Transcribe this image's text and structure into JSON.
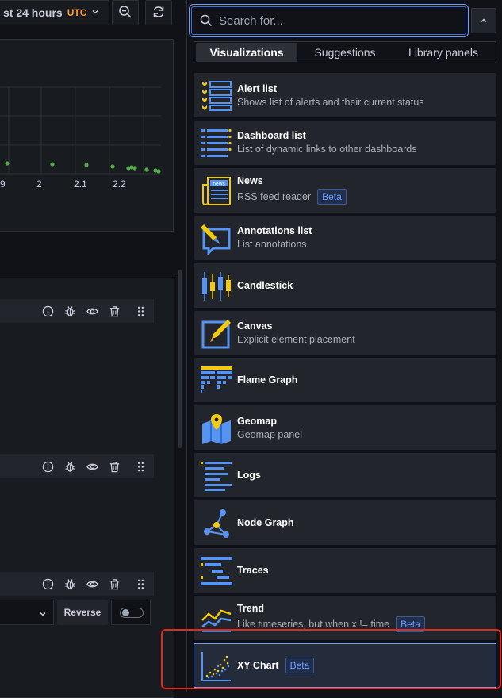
{
  "toolbar": {
    "time_range_label": "st 24 hours",
    "timezone_label": "UTC",
    "icons": [
      "chevron-down-icon",
      "zoom-out-icon",
      "refresh-icon"
    ]
  },
  "graph": {
    "x_ticks": [
      "9",
      "2",
      "2.1",
      "2.2"
    ],
    "point_color": "#56a64b"
  },
  "query_rows": {
    "icons": [
      "info-icon",
      "bug-icon",
      "eye-icon",
      "trash-icon",
      "drag-handle-icon"
    ],
    "reverse_label": "Reverse"
  },
  "search": {
    "placeholder": "Search for..."
  },
  "tabs": [
    {
      "label": "Visualizations",
      "active": true
    },
    {
      "label": "Suggestions",
      "active": false
    },
    {
      "label": "Library panels",
      "active": false
    }
  ],
  "visualizations": [
    {
      "name": "Alert list",
      "description": "Shows list of alerts and their current status",
      "icon": "alert-list-icon"
    },
    {
      "name": "Dashboard list",
      "description": "List of dynamic links to other dashboards",
      "icon": "dashboard-list-icon"
    },
    {
      "name": "News",
      "description": "RSS feed reader",
      "badge": "Beta",
      "icon": "news-icon"
    },
    {
      "name": "Annotations list",
      "description": "List annotations",
      "icon": "annotations-list-icon"
    },
    {
      "name": "Candlestick",
      "description": "",
      "icon": "candlestick-icon"
    },
    {
      "name": "Canvas",
      "description": "Explicit element placement",
      "icon": "canvas-icon"
    },
    {
      "name": "Flame Graph",
      "description": "",
      "icon": "flame-graph-icon"
    },
    {
      "name": "Geomap",
      "description": "Geomap panel",
      "icon": "geomap-icon"
    },
    {
      "name": "Logs",
      "description": "",
      "icon": "logs-icon"
    },
    {
      "name": "Node Graph",
      "description": "",
      "icon": "node-graph-icon"
    },
    {
      "name": "Traces",
      "description": "",
      "icon": "traces-icon"
    },
    {
      "name": "Trend",
      "description": "Like timeseries, but when x != time",
      "badge": "Beta",
      "icon": "trend-icon"
    },
    {
      "name": "XY Chart",
      "description": "",
      "badge": "Beta",
      "icon": "xy-chart-icon",
      "selected": true
    }
  ],
  "colors": {
    "accent": "#6e9fff",
    "highlight": "#e5291d",
    "utc": "#ff9830"
  }
}
